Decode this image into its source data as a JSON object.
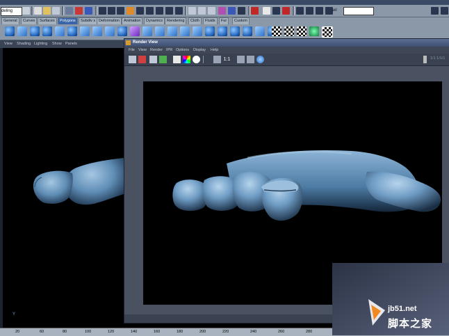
{
  "toolbar": {
    "mode_value": "deling",
    "sel_label": "sel",
    "sel_value": ""
  },
  "shelf_tabs": [
    "General",
    "Curves",
    "Surfaces",
    "Polygons",
    "Subdiv s",
    "Deformation",
    "Animation",
    "Dynamics",
    "Rendering",
    "Cloth",
    "Fluids",
    "Fur",
    "Custom"
  ],
  "shelf_active": "Polygons",
  "viewport": {
    "menu": [
      "View",
      "Shading",
      "Lighting",
      "Show",
      "Panels"
    ],
    "axis_label": "Y"
  },
  "render_view": {
    "title": "Render View",
    "menu": [
      "File",
      "View",
      "Render",
      "IPR",
      "Options",
      "Display",
      "Help"
    ],
    "status_text": "",
    "right_toolbar_text": "1/1  1/1/1"
  },
  "timeline": {
    "ticks": [
      "20",
      "60",
      "80",
      "100",
      "120",
      "140",
      "160",
      "180",
      "200",
      "220",
      "240",
      "260",
      "280"
    ]
  },
  "watermark": {
    "url": "jb51.net",
    "site": "脚本之家"
  },
  "colors": {
    "ui_gray": "#8b98a8",
    "panel_dark": "#3a4252",
    "model_blue": "#5f8db5",
    "active_tab": "#3a64a8"
  }
}
